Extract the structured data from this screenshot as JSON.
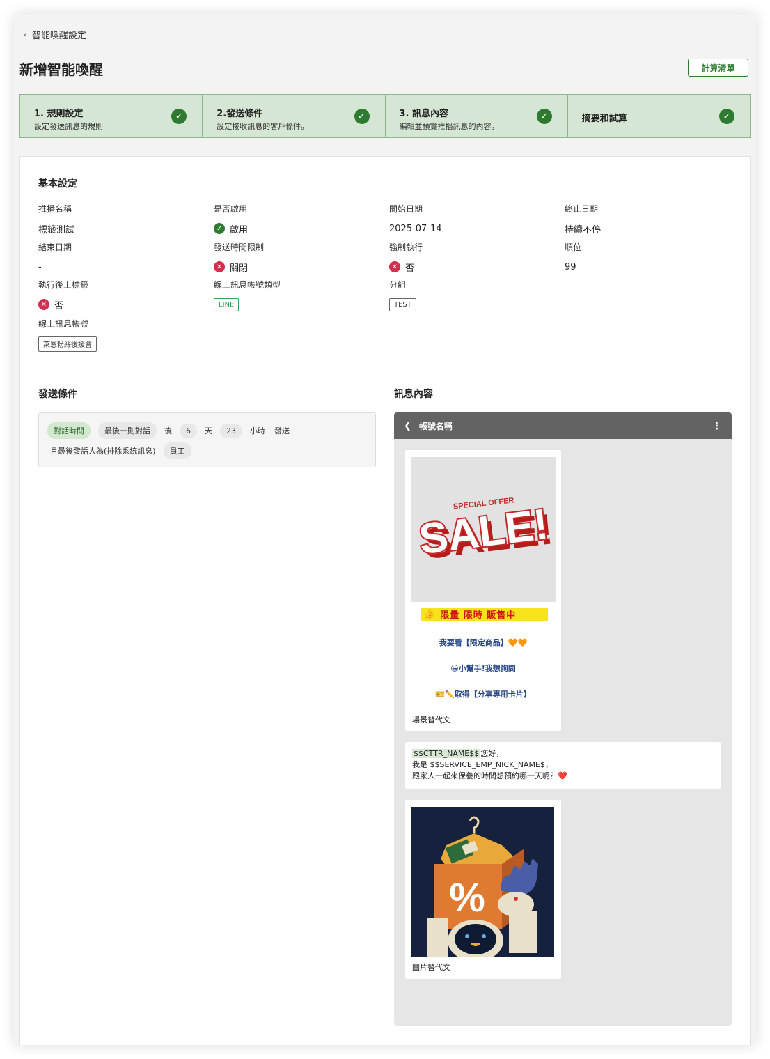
{
  "breadcrumb": {
    "back_label": "智能喚醒設定"
  },
  "page": {
    "title": "新增智能喚醒",
    "calc_button": "計算清單"
  },
  "steps": [
    {
      "title": "1. 規則設定",
      "desc": "設定發送訊息的規則",
      "done": true
    },
    {
      "title": "2.發送條件",
      "desc": "設定接收訊息的客戶條件。",
      "done": true
    },
    {
      "title": "3. 訊息內容",
      "desc": "編輯並預覽推播訊息的內容。",
      "done": true
    },
    {
      "title": "摘要和試算",
      "desc": "",
      "done": true
    }
  ],
  "basic": {
    "title": "基本設定",
    "push_name": {
      "label": "推播名稱",
      "value": "標籤測試"
    },
    "enabled": {
      "label": "是否啟用",
      "value": "啟用"
    },
    "start_date": {
      "label": "開始日期",
      "value": "2025-07-14"
    },
    "stop_date": {
      "label": "終止日期",
      "value": "持續不停"
    },
    "end_date": {
      "label": "結束日期",
      "value": "-"
    },
    "time_limit": {
      "label": "發送時間限制",
      "value": "關閉"
    },
    "force_exec": {
      "label": "強制執行",
      "value": "否"
    },
    "order": {
      "label": "順位",
      "value": "99"
    },
    "tag_after": {
      "label": "執行後上標籤",
      "value": "否"
    },
    "account_type": {
      "label": "線上訊息帳號類型",
      "value": "LINE"
    },
    "group": {
      "label": "分組",
      "value": "TEST"
    },
    "account": {
      "label": "線上訊息帳號",
      "value": "萊恩粉絲後援會"
    }
  },
  "conditions": {
    "title": "發送條件",
    "row1": {
      "chip_type": "對話時間",
      "chip_scope": "最後一則對話",
      "w_after": "後",
      "days": "6",
      "w_day": "天",
      "hours": "23",
      "w_hour": "小時",
      "w_send": "發送"
    },
    "row2": {
      "text": "且最後發話人為(排除系統訊息)",
      "chip_role": "員工"
    }
  },
  "message": {
    "title": "訊息內容",
    "phone_header": "帳號名稱",
    "card1": {
      "img_text_top": "SPECIAL OFFER",
      "img_text_main": "SALE!",
      "banner": "限量 限時 販售中",
      "action1": "我要看【限定商品】🧡🧡",
      "action2": "😀小幫手!我想詢問",
      "action3": "🎫✏️取得【分享專用卡片】",
      "alt": "場景替代文"
    },
    "card2": {
      "var_name": "$$CTTR_NAME$$",
      "line1_rest": "您好，",
      "line2": "我是 $$SERVICE_EMP_NICK_NAME$，",
      "line3": "跟家人一起來保養的時間想預約哪一天呢？❤️"
    },
    "card3": {
      "alt": "圖片替代文"
    }
  },
  "colors": {
    "accent_green": "#2d7a30",
    "step_bg": "#d6e6d4",
    "error_red": "#d32f4f",
    "banner_yellow": "#f7e31b"
  },
  "icons": {
    "back": "chevron-left-icon",
    "check": "check-circle-icon",
    "cross": "x-circle-icon",
    "more": "more-vertical-icon"
  }
}
